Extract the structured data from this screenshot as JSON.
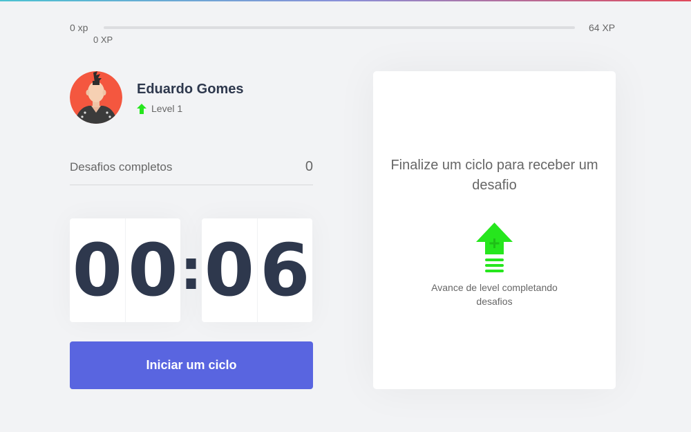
{
  "experience": {
    "min_label": "0 xp",
    "max_label": "64 XP",
    "current_label": "0 XP",
    "progress_percent": 0,
    "accent_color": "#4cd62b"
  },
  "profile": {
    "name": "Eduardo Gomes",
    "level_label": "Level 1",
    "level_icon": "level-up-arrow-icon",
    "avatar": "punk-avatar"
  },
  "completed_challenges": {
    "label": "Desafios completos",
    "count": "0"
  },
  "countdown": {
    "minute_left": "0",
    "minute_right": "0",
    "separator": ":",
    "second_left": "0",
    "second_right": "6",
    "digit_color": "#2e384d"
  },
  "start_button": {
    "label": "Iniciar um ciclo",
    "color": "#5965e0"
  },
  "challenge_box": {
    "title": "Finalize um ciclo para receber um desafio",
    "hint": "Avance de level completando desafios",
    "icon": "level-up-icon",
    "icon_color": "#26e61d"
  }
}
